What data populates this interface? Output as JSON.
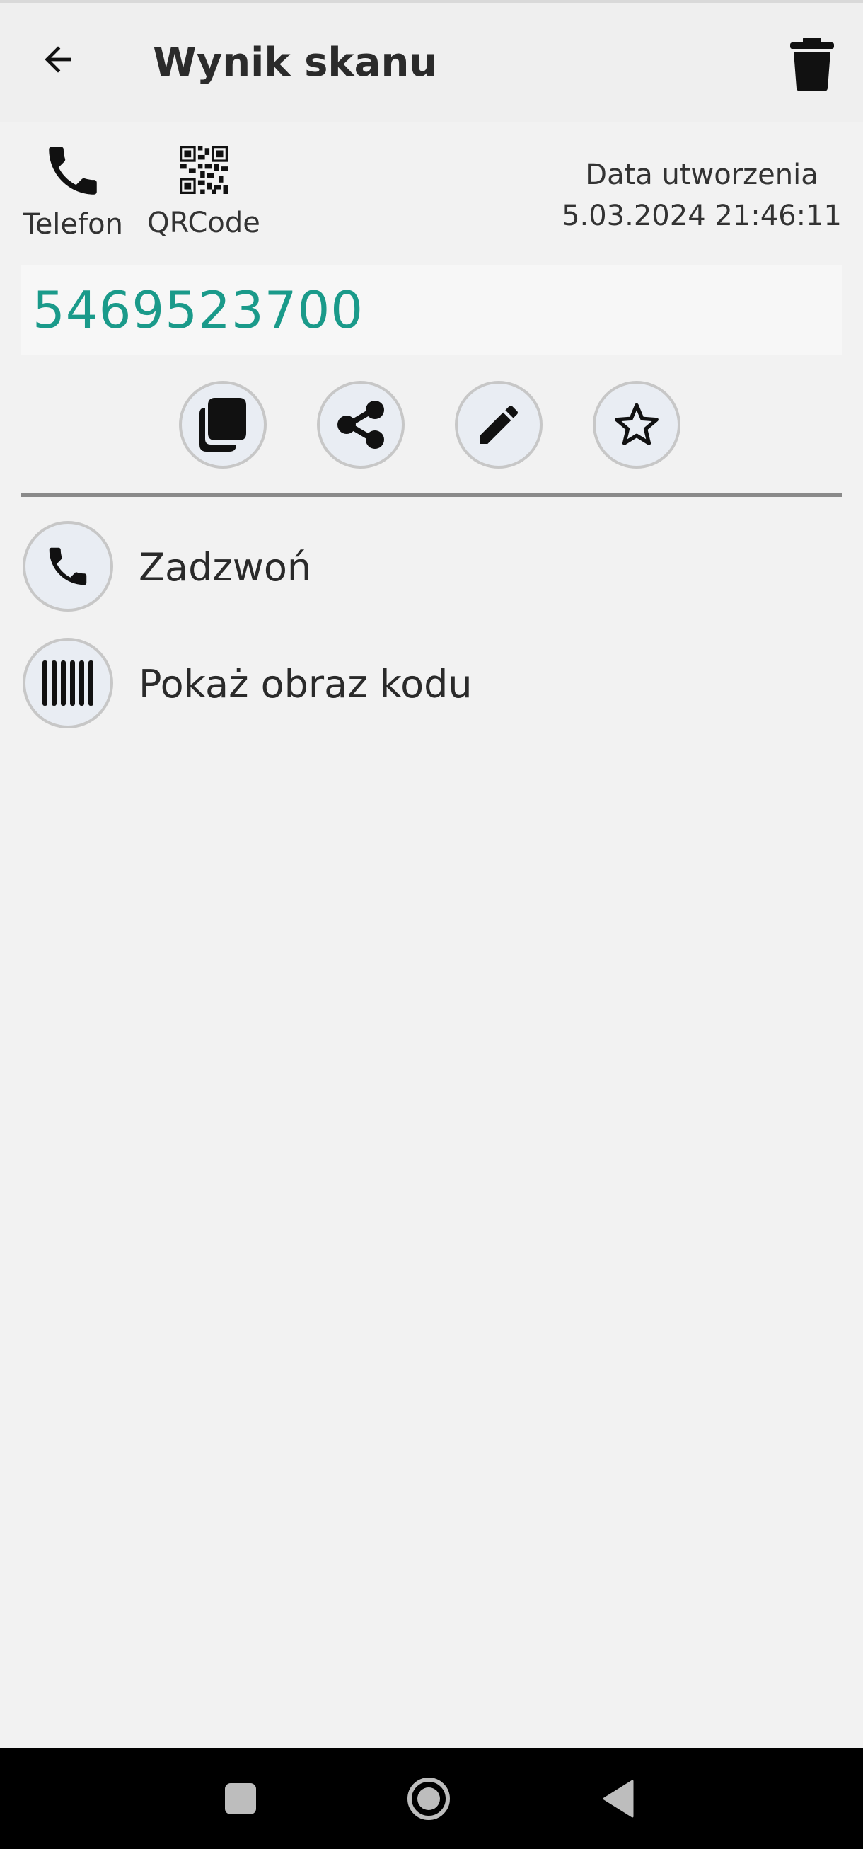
{
  "appbar": {
    "title": "Wynik skanu",
    "back_icon": "arrow-left-icon",
    "delete_icon": "trash-icon"
  },
  "code_info": {
    "type_label": "Telefon",
    "type_icon": "phone-icon",
    "format_label": "QRCode",
    "format_icon": "qr-code-icon",
    "date_label": "Data utworzenia",
    "date_value": "5.03.2024 21:46:11"
  },
  "scan_value": "5469523700",
  "actions": [
    {
      "icon": "copy-icon"
    },
    {
      "icon": "share-icon"
    },
    {
      "icon": "edit-icon"
    },
    {
      "icon": "star-icon"
    }
  ],
  "list": [
    {
      "label": "Zadzwoń",
      "icon": "phone-icon"
    },
    {
      "label": "Pokaż obraz kodu",
      "icon": "barcode-icon"
    }
  ],
  "colors": {
    "value_text": "#1a9a8a",
    "background": "#f2f2f2",
    "nav_bar": "#000000"
  },
  "system_nav": [
    "recent-apps-icon",
    "home-icon",
    "back-icon"
  ]
}
